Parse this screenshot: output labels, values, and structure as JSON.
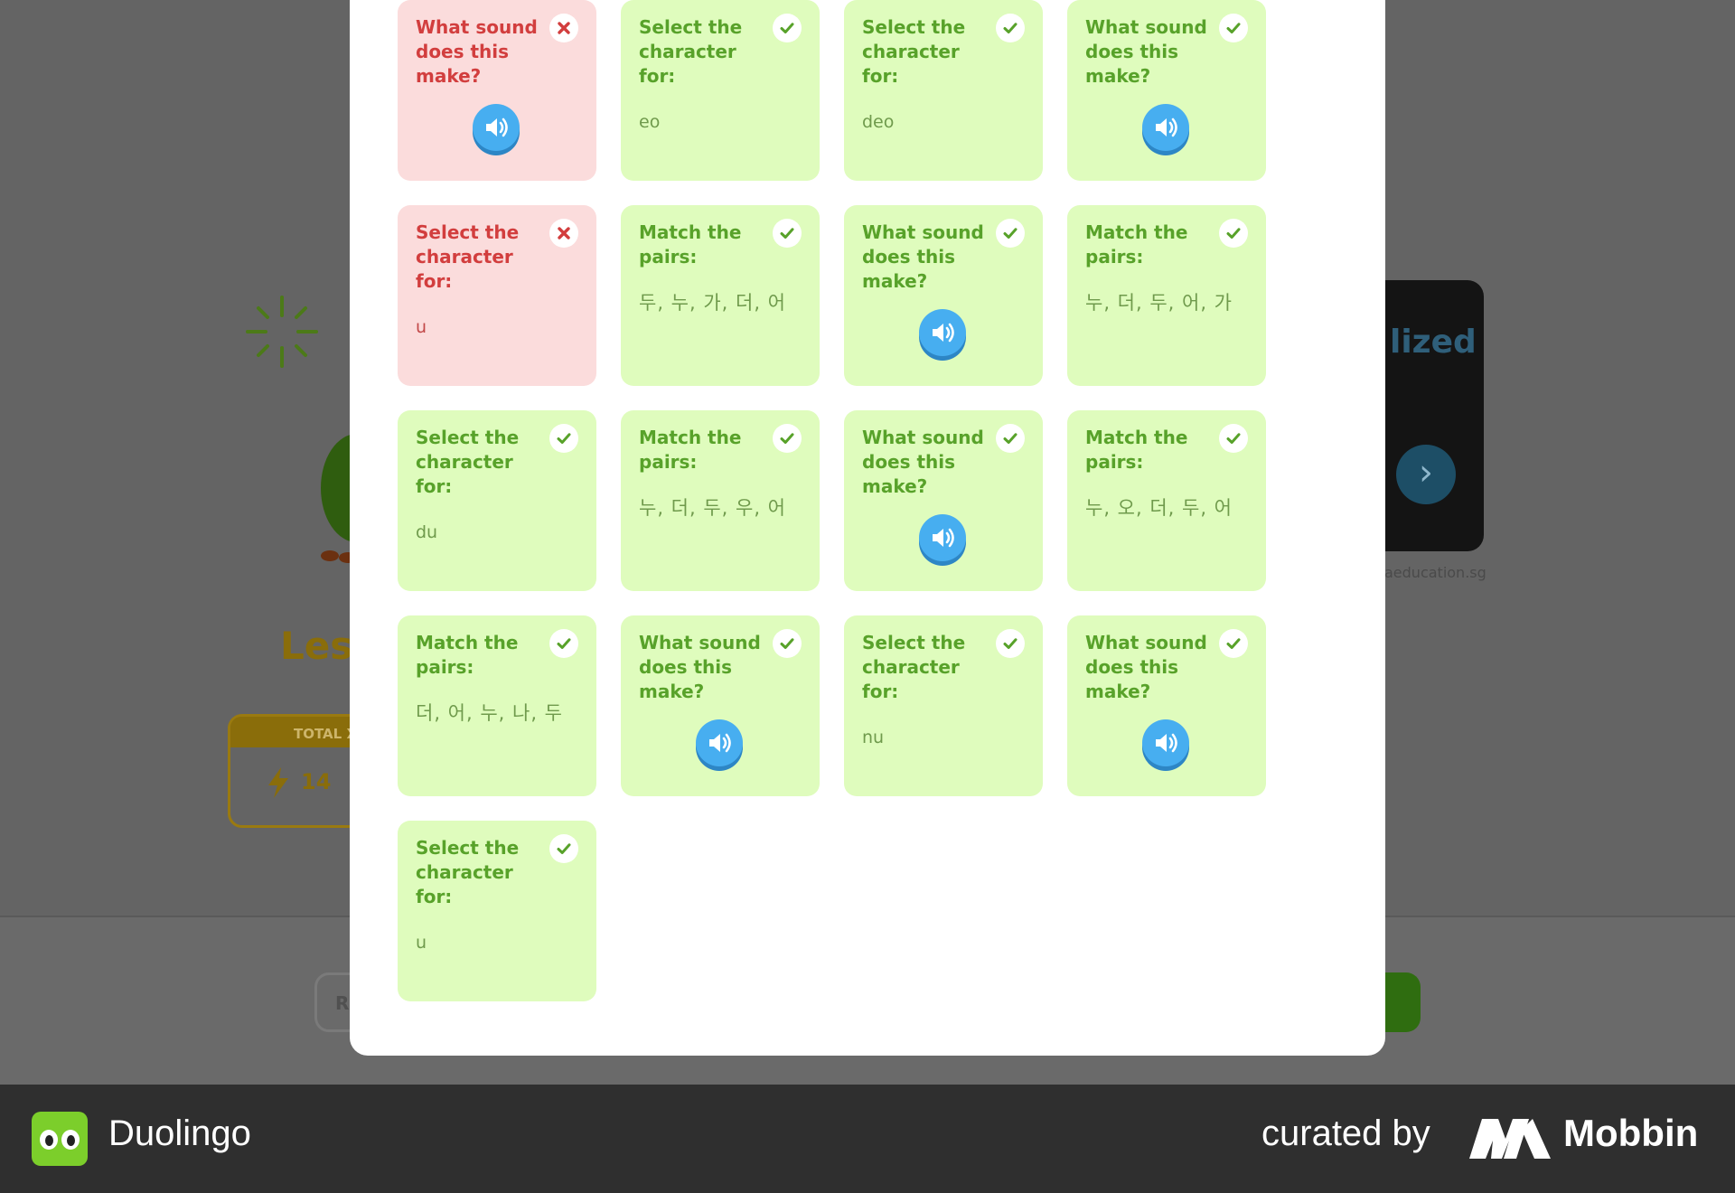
{
  "background": {
    "lesson_title_partial": "Less",
    "xp_label_partial": "TOTAL X",
    "xp_value_partial": "14",
    "ad_text_partial": "lized",
    "ad_caption_partial": "aeducation.sg",
    "review_button_partial": "R"
  },
  "review": {
    "cards": [
      {
        "title": "What sound does this make?",
        "type": "audio",
        "status": "wrong"
      },
      {
        "title": "Select the character for:",
        "type": "text",
        "value": "eo",
        "status": "correct"
      },
      {
        "title": "Select the character for:",
        "type": "text",
        "value": "deo",
        "status": "correct"
      },
      {
        "title": "What sound does this make?",
        "type": "audio",
        "status": "correct"
      },
      {
        "title": "Select the character for:",
        "type": "text",
        "value": "u",
        "status": "wrong"
      },
      {
        "title": "Match the pairs:",
        "type": "pairs",
        "value": "두, 누, 가, 더, 어",
        "status": "correct"
      },
      {
        "title": "What sound does this make?",
        "type": "audio",
        "status": "correct"
      },
      {
        "title": "Match the pairs:",
        "type": "pairs",
        "value": "누, 더, 두, 어, 가",
        "status": "correct"
      },
      {
        "title": "Select the character for:",
        "type": "text",
        "value": "du",
        "status": "correct"
      },
      {
        "title": "Match the pairs:",
        "type": "pairs",
        "value": "누, 더, 두, 우, 어",
        "status": "correct"
      },
      {
        "title": "What sound does this make?",
        "type": "audio",
        "status": "correct"
      },
      {
        "title": "Match the pairs:",
        "type": "pairs",
        "value": "누, 오, 더, 두, 어",
        "status": "correct"
      },
      {
        "title": "Match the pairs:",
        "type": "pairs",
        "value": "더, 어, 누, 나, 두",
        "status": "correct"
      },
      {
        "title": "What sound does this make?",
        "type": "audio",
        "status": "correct"
      },
      {
        "title": "Select the character for:",
        "type": "text",
        "value": "nu",
        "status": "correct"
      },
      {
        "title": "What sound does this make?",
        "type": "audio",
        "status": "correct"
      },
      {
        "title": "Select the character for:",
        "type": "text",
        "value": "u",
        "status": "correct"
      }
    ]
  },
  "footer": {
    "brand": "Duolingo",
    "curated_by": "curated by",
    "curator": "Mobbin"
  },
  "colors": {
    "correct_bg": "#dffcbd",
    "wrong_bg": "#fbdcdc",
    "correct_text": "#58a22a",
    "wrong_text": "#d23e3e",
    "audio_blue": "#47aef0"
  }
}
